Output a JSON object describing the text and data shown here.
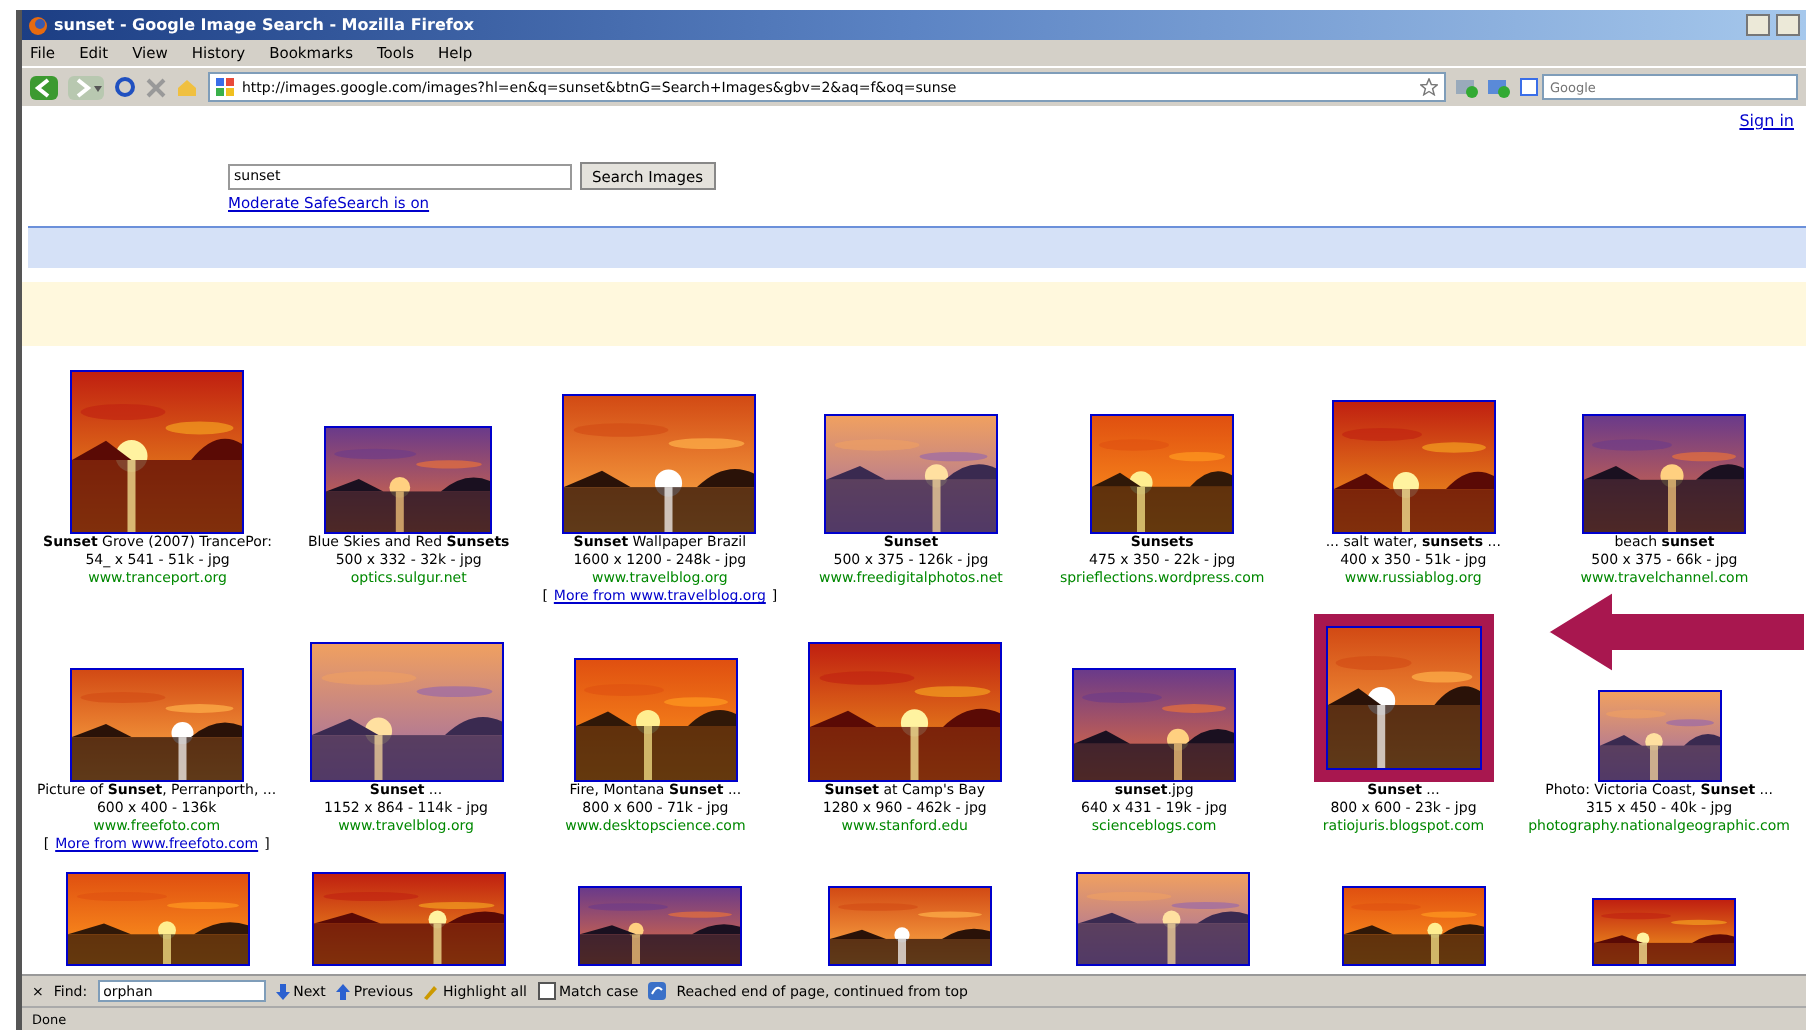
{
  "window": {
    "title": "sunset - Google Image Search - Mozilla Firefox"
  },
  "menu": [
    "File",
    "Edit",
    "View",
    "History",
    "Bookmarks",
    "Tools",
    "Help"
  ],
  "address_bar": {
    "url": "http://images.google.com/images?hl=en&q=sunset&btnG=Search+Images&gbv=2&aq=f&oq=sunse"
  },
  "search_engine": {
    "placeholder": "Google"
  },
  "page": {
    "sign_in": "Sign in",
    "search": {
      "value": "sunset",
      "button": "Search Images",
      "safesearch": "Moderate SafeSearch is on"
    },
    "results": [
      [
        {
          "title": "**Sunset** Grove (2007) TrancePor:",
          "info": "54_ x 541 - 51k - jpg",
          "site": "www.tranceport.org",
          "highlighted": false
        },
        {
          "title": "Blue Skies and Red **Sunsets**",
          "info": "500 x 332 - 32k - jpg",
          "site": "optics.sulgur.net",
          "highlighted": false
        },
        {
          "title": "**Sunset** Wallpaper Brazil",
          "info": "1600 x 1200 - 248k - jpg",
          "site": "www.travelblog.org",
          "more": {
            "open": "[",
            "link": "More from www.travelblog.org",
            "close": "]"
          },
          "highlighted": false
        },
        {
          "title": "**Sunset**",
          "info": "500 x 375 - 126k - jpg",
          "site": "www.freedigitalphotos.net",
          "highlighted": false
        },
        {
          "title": "**Sunsets**",
          "info": "475 x 350 - 22k - jpg",
          "site": "sprieflections.wordpress.com",
          "highlighted": false
        },
        {
          "title": "... salt water, **sunsets** ...",
          "info": "400 x 350 - 51k - jpg",
          "site": "www.russiablog.org",
          "highlighted": false
        },
        {
          "title": "beach **sunset**",
          "info": "500 x 375 - 66k - jpg",
          "site": "www.travelchannel.com",
          "highlighted": false
        }
      ],
      [
        {
          "title": "Picture of **Sunset**, Perranporth, ...",
          "info": "600 x 400 - 136k",
          "site": "www.freefoto.com",
          "more": {
            "open": "[",
            "link": "More from www.freefoto.com",
            "close": "]"
          },
          "highlighted": false
        },
        {
          "title": "**Sunset** ...",
          "info": "1152 x 864 - 114k - jpg",
          "site": "www.travelblog.org",
          "highlighted": false
        },
        {
          "title": "Fire, Montana **Sunset** ...",
          "info": "800 x 600 - 71k - jpg",
          "site": "www.desktopscience.com",
          "highlighted": false
        },
        {
          "title": "**Sunset** at Camp's Bay",
          "info": "1280 x 960 - 462k - jpg",
          "site": "www.stanford.edu",
          "highlighted": false
        },
        {
          "title": "**sunset**.jpg",
          "info": "640 x 431 - 19k - jpg",
          "site": "scienceblogs.com",
          "highlighted": false
        },
        {
          "title": "**Sunset** ...",
          "info": "800 x 600 - 23k - jpg",
          "site": "ratiojuris.blogspot.com",
          "highlighted": true
        },
        {
          "title": "Photo: Victoria Coast, **Sunset** ...",
          "info": "315 x 450 - 40k - jpg",
          "site": "photography.nationalgeographic.com",
          "highlighted": false
        }
      ],
      [
        {
          "highlighted": false
        },
        {
          "highlighted": false
        },
        {
          "highlighted": false
        },
        {
          "highlighted": false
        },
        {
          "highlighted": false
        },
        {
          "highlighted": false
        },
        {
          "highlighted": false
        }
      ]
    ]
  },
  "find_bar": {
    "close": "×",
    "label": "Find:",
    "value": "orphan",
    "next": "Next",
    "previous": "Previous",
    "highlight": "Highlight all",
    "match_case": {
      "label": "Match case",
      "checked": false
    },
    "message": "Reached end of page, continued from top"
  },
  "status_bar": "Done"
}
